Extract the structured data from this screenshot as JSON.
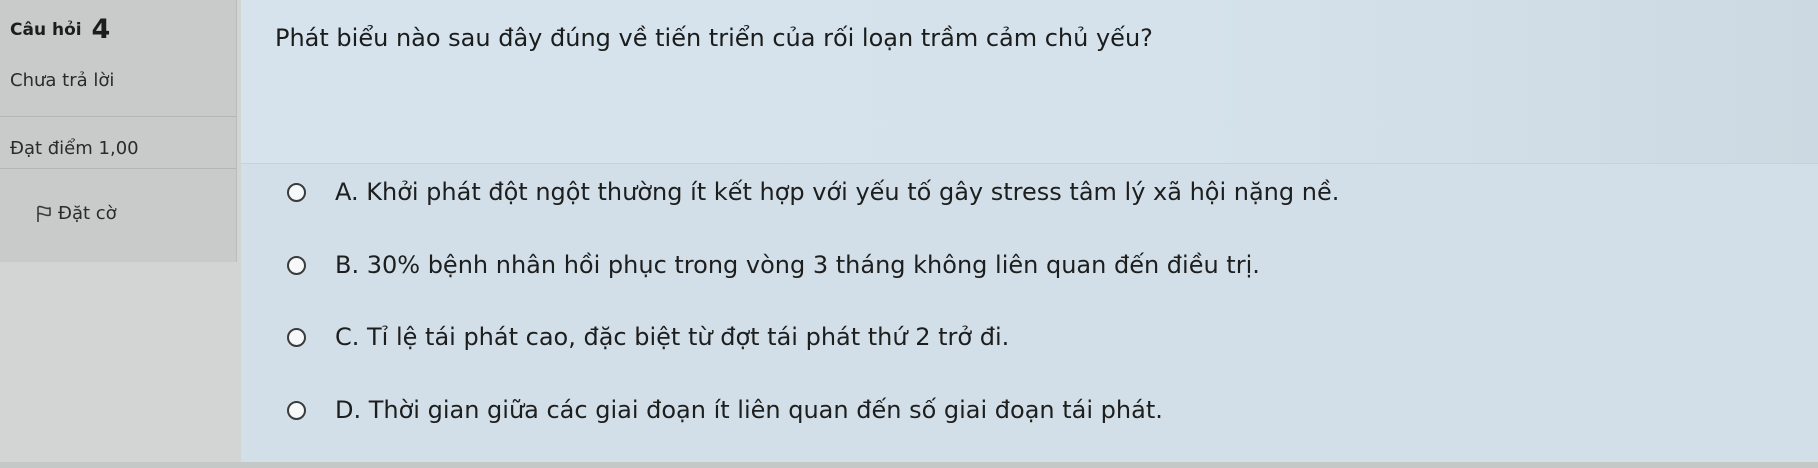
{
  "info": {
    "question_label": "Câu hỏi",
    "question_number": "4",
    "status": "Chưa trả lời",
    "grade": "Đạt điểm 1,00",
    "flag_label": "Đặt cờ"
  },
  "question": {
    "text": "Phát biểu nào sau đây đúng về tiến triển của rối loạn trầm cảm chủ yếu?",
    "options": [
      "A. Khởi phát đột ngột thường ít kết hợp với yếu tố gây stress tâm lý xã hội nặng nề.",
      "B. 30% bệnh nhân hồi phục trong vòng 3 tháng không liên quan đến điều trị.",
      "C. Tỉ lệ tái phát cao, đặc biệt từ đợt tái phát thứ 2 trở đi.",
      "D. Thời gian giữa các giai đoạn ít liên quan đến số giai đoạn tái phát."
    ],
    "selected": null
  },
  "icons": {
    "flag": "flag-icon",
    "radio": "radio-unchecked-icon"
  }
}
